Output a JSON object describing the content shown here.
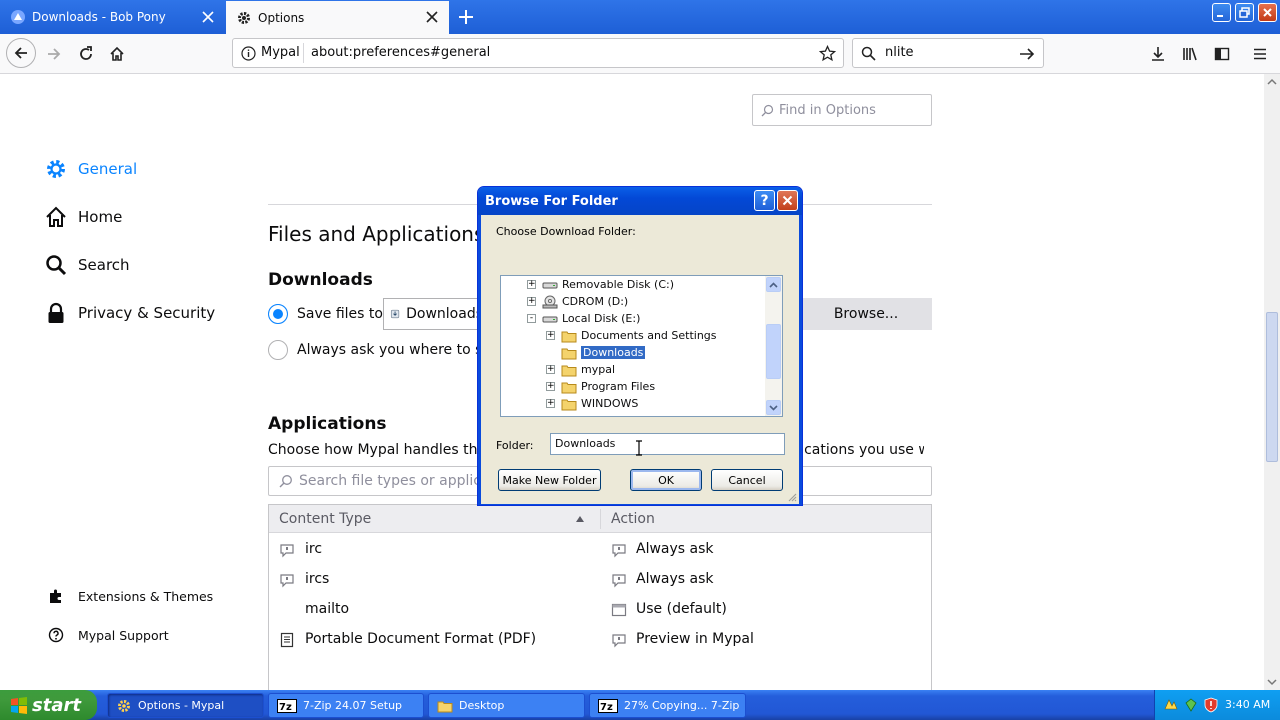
{
  "browser": {
    "tabs": [
      {
        "label": "Downloads - Bob Pony",
        "active": false
      },
      {
        "label": "Options",
        "active": true
      }
    ],
    "url_identity": "Mypal",
    "url": "about:preferences#general",
    "search_value": "nlite"
  },
  "prefs": {
    "find_placeholder": "Find in Options",
    "categories": [
      {
        "label": "General",
        "icon": "gear-icon",
        "selected": true
      },
      {
        "label": "Home",
        "icon": "home-icon"
      },
      {
        "label": "Search",
        "icon": "search-icon"
      },
      {
        "label": "Privacy & Security",
        "icon": "lock-icon"
      }
    ],
    "bottom_links": [
      {
        "label": "Extensions & Themes",
        "icon": "puzzle-icon"
      },
      {
        "label": "Mypal Support",
        "icon": "help-icon"
      }
    ],
    "files_heading": "Files and Applications",
    "downloads_heading": "Downloads",
    "save_files_label": "Save files to",
    "download_folder": "Downloads",
    "browse_label": "Browse...",
    "always_ask_label": "Always ask you where to save files",
    "applications_heading": "Applications",
    "applications_desc": "Choose how Mypal handles the files you download from the web or the applications you use while browsing.",
    "app_search_placeholder": "Search file types or applications",
    "table": {
      "col_content": "Content Type",
      "col_action": "Action",
      "rows": [
        {
          "type": "irc",
          "action": "Always ask"
        },
        {
          "type": "ircs",
          "action": "Always ask"
        },
        {
          "type": "mailto",
          "action": "Use  (default)"
        },
        {
          "type": "Portable Document Format (PDF)",
          "action": "Preview in Mypal"
        }
      ]
    }
  },
  "dialog": {
    "title": "Browse For Folder",
    "help": "?",
    "prompt": "Choose Download Folder:",
    "tree": [
      {
        "label": "Removable Disk (C:)",
        "level": 0,
        "expander": "+"
      },
      {
        "label": "CDROM (D:)",
        "level": 0,
        "expander": "+"
      },
      {
        "label": "Local Disk (E:)",
        "level": 0,
        "expander": "-"
      },
      {
        "label": "Documents and Settings",
        "level": 1,
        "expander": "+"
      },
      {
        "label": "Downloads",
        "level": 1,
        "expander": "",
        "selected": true
      },
      {
        "label": "mypal",
        "level": 1,
        "expander": "+"
      },
      {
        "label": "Program Files",
        "level": 1,
        "expander": "+"
      },
      {
        "label": "WINDOWS",
        "level": 1,
        "expander": "+"
      }
    ],
    "folder_label": "Folder:",
    "folder_value": "Downloads",
    "make_new_folder": "Make New Folder",
    "ok": "OK",
    "cancel": "Cancel"
  },
  "taskbar": {
    "start": "start",
    "tasks": [
      {
        "label": "Options - Mypal",
        "active": true
      },
      {
        "label": "7-Zip 24.07 Setup"
      },
      {
        "label": "Desktop"
      },
      {
        "label": "27% Copying... 7-Zip"
      }
    ],
    "clock": "3:40 AM"
  },
  "colors": {
    "accent": "#0a84ff",
    "xp_blue": "#245edb",
    "xp_start": "#3c9c3d"
  }
}
